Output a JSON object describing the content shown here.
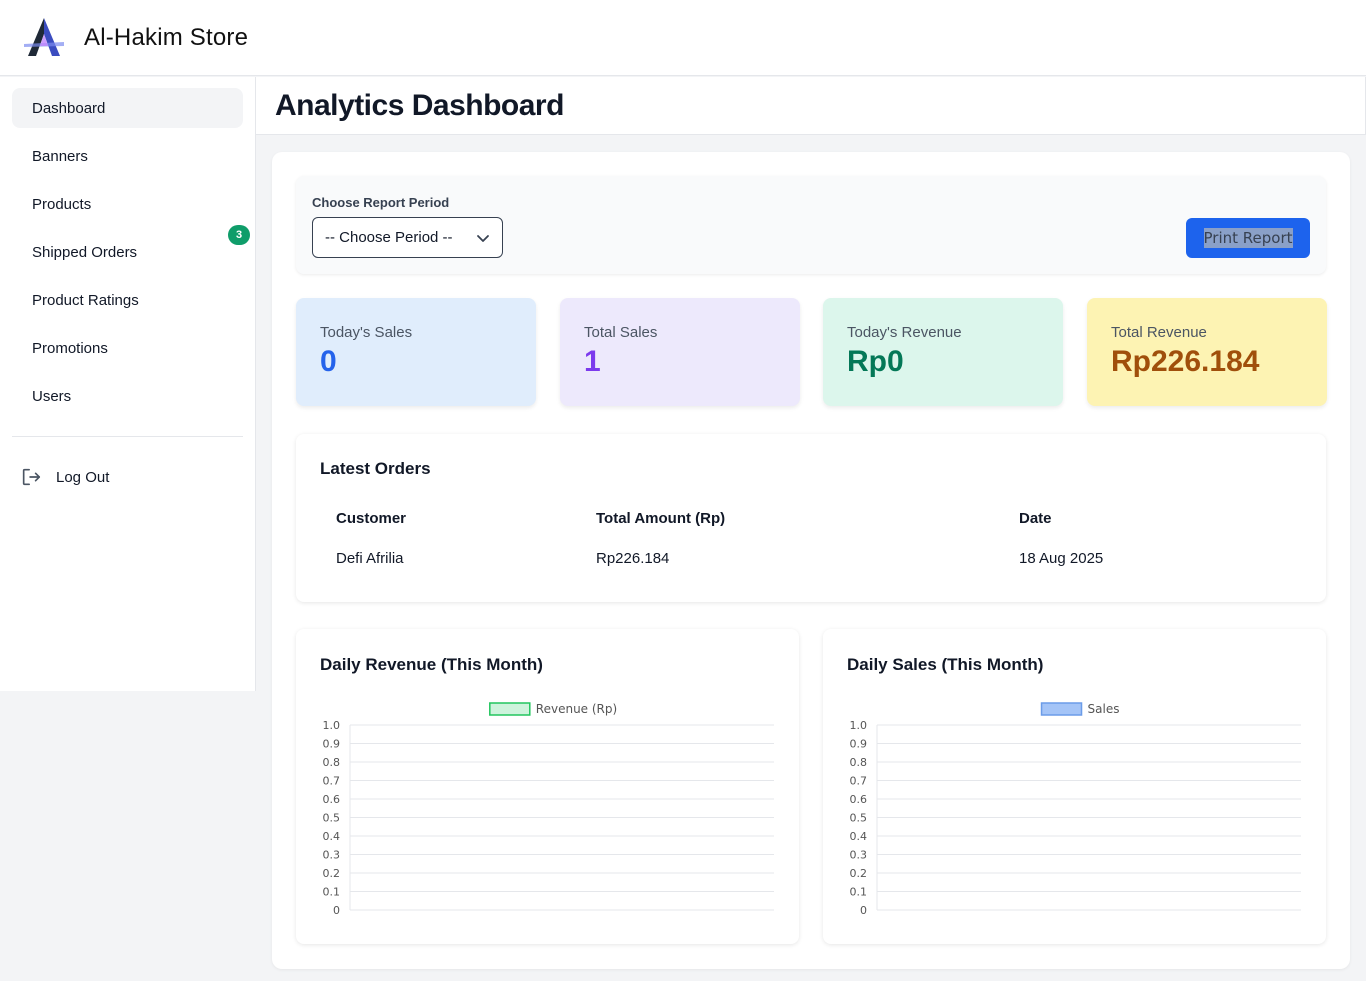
{
  "app": {
    "brand": "Al-Hakim Store"
  },
  "sidebar": {
    "items": [
      {
        "label": "Dashboard",
        "active": true
      },
      {
        "label": "Banners"
      },
      {
        "label": "Products"
      },
      {
        "label": "Shipped Orders",
        "badge": "3"
      },
      {
        "label": "Product Ratings"
      },
      {
        "label": "Promotions"
      },
      {
        "label": "Users"
      }
    ],
    "logout_label": "Log Out"
  },
  "header": {
    "title": "Analytics Dashboard"
  },
  "report": {
    "label": "Choose Report Period",
    "select_value": "-- Choose Period --",
    "print_label": "Print Report"
  },
  "stats": [
    {
      "label": "Today's Sales",
      "value": "0",
      "bg": "#e0edfc",
      "color": "#2563eb"
    },
    {
      "label": "Total Sales",
      "value": "1",
      "bg": "#ede9fc",
      "color": "#7c3aed"
    },
    {
      "label": "Today's Revenue",
      "value": "Rp0",
      "bg": "#dcf6ec",
      "color": "#047857"
    },
    {
      "label": "Total Revenue",
      "value": "Rp226.184",
      "bg": "#fdf3b3",
      "color": "#a04f0b"
    }
  ],
  "orders": {
    "title": "Latest Orders",
    "columns": [
      "Customer",
      "Total Amount (Rp)",
      "Date"
    ],
    "rows": [
      [
        "Defi Afrilia",
        "Rp226.184",
        "18 Aug 2025"
      ]
    ]
  },
  "chart_data": [
    {
      "type": "bar",
      "title": "Daily Revenue (This Month)",
      "series": [
        {
          "name": "Revenue (Rp)",
          "values": [],
          "fill": "#cdf3dc",
          "stroke": "#22c55e"
        }
      ],
      "categories": [],
      "ylim": [
        0,
        1.0
      ],
      "yticks": [
        "1.0",
        "0.9",
        "0.8",
        "0.7",
        "0.6",
        "0.5",
        "0.4",
        "0.3",
        "0.2",
        "0.1",
        "0"
      ],
      "grid": true,
      "legend": "top-center"
    },
    {
      "type": "bar",
      "title": "Daily Sales (This Month)",
      "series": [
        {
          "name": "Sales",
          "values": [],
          "fill": "#a4c4f7",
          "stroke": "#6b9ce8"
        }
      ],
      "categories": [],
      "ylim": [
        0,
        1.0
      ],
      "yticks": [
        "1.0",
        "0.9",
        "0.8",
        "0.7",
        "0.6",
        "0.5",
        "0.4",
        "0.3",
        "0.2",
        "0.1",
        "0"
      ],
      "grid": true,
      "legend": "top-center"
    }
  ]
}
